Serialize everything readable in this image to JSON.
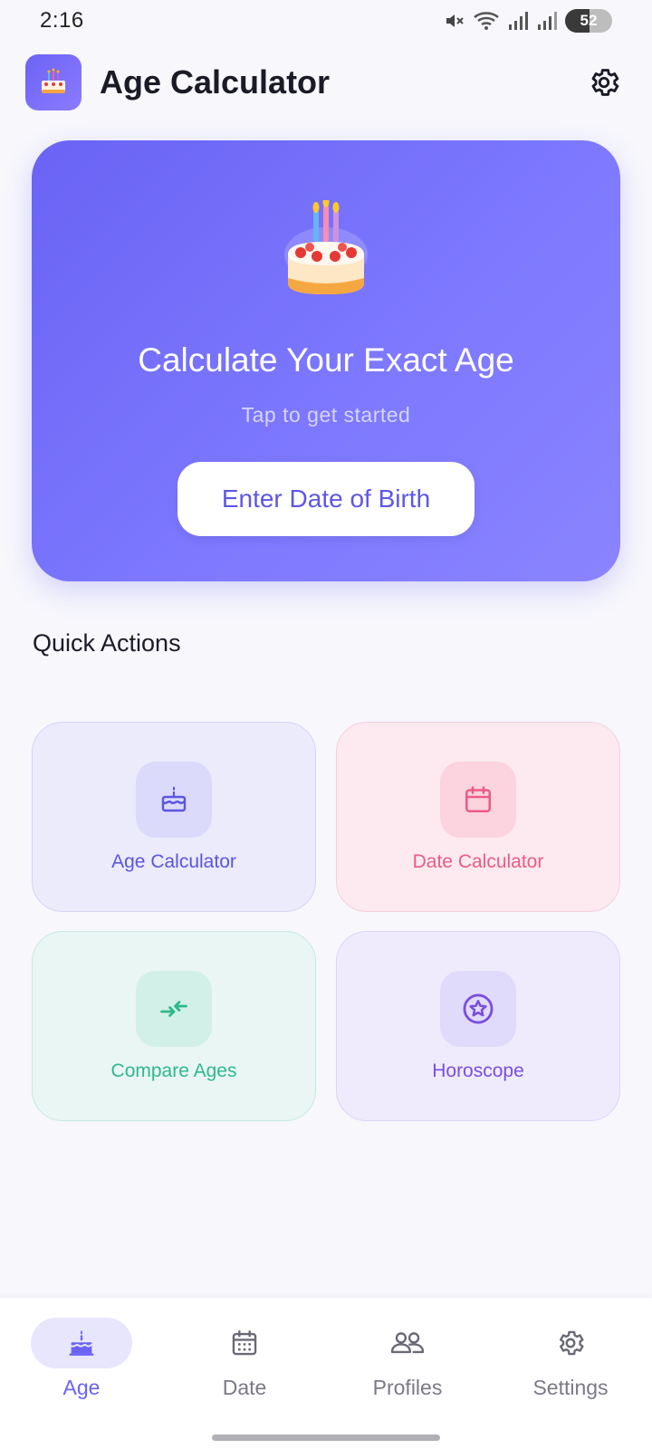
{
  "status_bar": {
    "time": "2:16",
    "battery_level": "52",
    "battery_fill_percent": 52,
    "icons": [
      "mute-icon",
      "wifi-icon",
      "signal-icon",
      "signal-icon",
      "battery-charging-icon"
    ]
  },
  "header": {
    "title": "Age Calculator",
    "logo_icon": "cake-icon",
    "settings_icon": "gear-icon"
  },
  "hero": {
    "icon": "birthday-cake-icon",
    "title": "Calculate Your Exact Age",
    "subtitle": "Tap to get started",
    "button_label": "Enter Date of Birth",
    "gradient_start": "#6a63f4",
    "gradient_end": "#8a84ff"
  },
  "quick_actions": {
    "title": "Quick Actions",
    "items": [
      {
        "label": "Age Calculator",
        "icon": "cake-icon",
        "color": "#5b55e0"
      },
      {
        "label": "Date Calculator",
        "icon": "calendar-icon",
        "color": "#ec5b86"
      },
      {
        "label": "Compare Ages",
        "icon": "compare-arrows-icon",
        "color": "#2fb98a"
      },
      {
        "label": "Horoscope",
        "icon": "star-circle-icon",
        "color": "#7a4ee0"
      }
    ]
  },
  "bottom_nav": {
    "items": [
      {
        "label": "Age",
        "icon": "cake-icon",
        "active": true
      },
      {
        "label": "Date",
        "icon": "calendar-icon",
        "active": false
      },
      {
        "label": "Profiles",
        "icon": "people-icon",
        "active": false
      },
      {
        "label": "Settings",
        "icon": "gear-icon",
        "active": false
      }
    ],
    "active_color": "#6a63f4",
    "inactive_color": "#7a7a86"
  }
}
